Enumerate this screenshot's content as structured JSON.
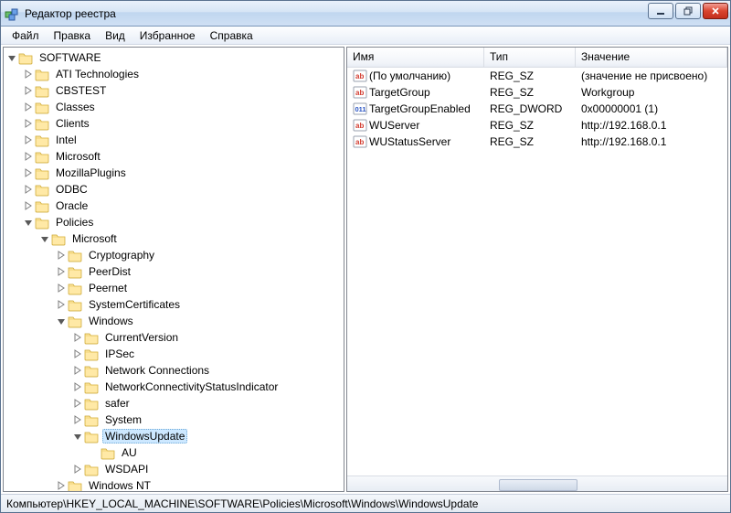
{
  "window": {
    "title": "Редактор реестра"
  },
  "menu": {
    "file": "Файл",
    "edit": "Правка",
    "view": "Вид",
    "favorites": "Избранное",
    "help": "Справка"
  },
  "tree": {
    "software": {
      "label": "SOFTWARE",
      "children": {
        "ati": "ATI Technologies",
        "cbstest": "CBSTEST",
        "classes": "Classes",
        "clients": "Clients",
        "intel": "Intel",
        "microsoft_top": "Microsoft",
        "mozilla": "MozillaPlugins",
        "odbc": "ODBC",
        "oracle": "Oracle",
        "policies": {
          "label": "Policies",
          "microsoft": {
            "label": "Microsoft",
            "children": {
              "cryptography": "Cryptography",
              "peerdist": "PeerDist",
              "peernet": "Peernet",
              "systemcerts": "SystemCertificates",
              "windows": {
                "label": "Windows",
                "children": {
                  "currentversion": "CurrentVersion",
                  "ipsec": "IPSec",
                  "netconn": "Network Connections",
                  "ncsi": "NetworkConnectivityStatusIndicator",
                  "safer": "safer",
                  "system": "System",
                  "windowsupdate": {
                    "label": "WindowsUpdate",
                    "au": "AU"
                  },
                  "wsdapi": "WSDAPI"
                }
              },
              "windowsnt": "Windows NT"
            }
          }
        }
      }
    }
  },
  "list": {
    "headers": {
      "name": "Имя",
      "type": "Тип",
      "value": "Значение"
    },
    "rows": [
      {
        "name": "(По умолчанию)",
        "type": "REG_SZ",
        "value": "(значение не присвоено)",
        "icon": "sz"
      },
      {
        "name": "TargetGroup",
        "type": "REG_SZ",
        "value": "Workgroup",
        "icon": "sz"
      },
      {
        "name": "TargetGroupEnabled",
        "type": "REG_DWORD",
        "value": "0x00000001 (1)",
        "icon": "dword"
      },
      {
        "name": "WUServer",
        "type": "REG_SZ",
        "value": "http://192.168.0.1",
        "icon": "sz"
      },
      {
        "name": "WUStatusServer",
        "type": "REG_SZ",
        "value": "http://192.168.0.1",
        "icon": "sz"
      }
    ]
  },
  "status": {
    "path": "Компьютер\\HKEY_LOCAL_MACHINE\\SOFTWARE\\Policies\\Microsoft\\Windows\\WindowsUpdate"
  }
}
